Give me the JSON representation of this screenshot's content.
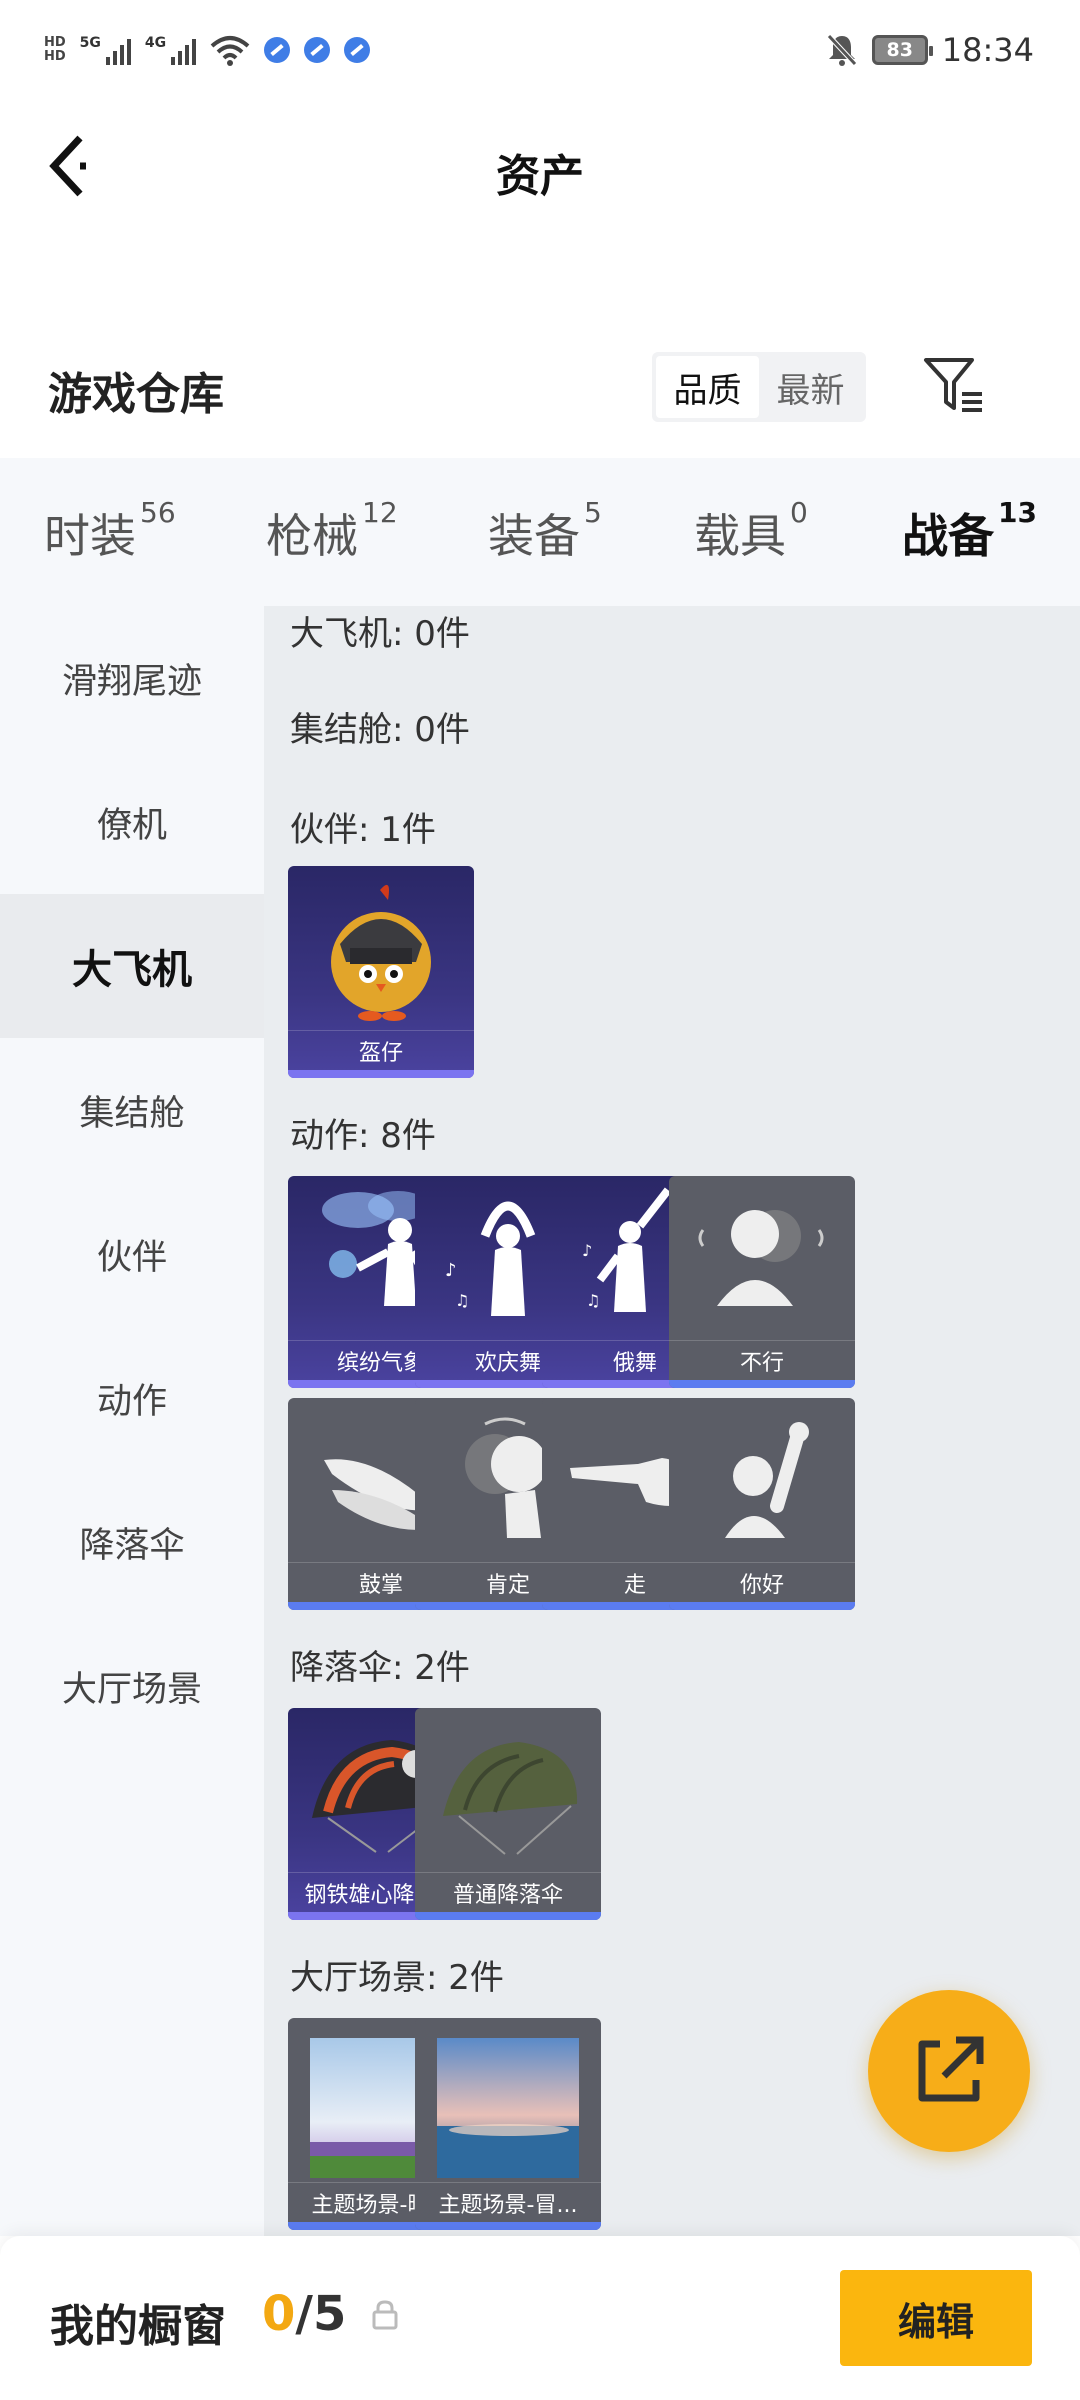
{
  "status_bar": {
    "network1": "5G",
    "network2": "4G",
    "battery": "83",
    "time": "18:34"
  },
  "header": {
    "title": "资产"
  },
  "section": {
    "title": "游戏仓库",
    "sort_options": [
      "品质",
      "最新"
    ]
  },
  "tabs": [
    {
      "label": "时装",
      "count": "56"
    },
    {
      "label": "枪械",
      "count": "12"
    },
    {
      "label": "装备",
      "count": "5"
    },
    {
      "label": "载具",
      "count": "0"
    },
    {
      "label": "战备",
      "count": "13"
    }
  ],
  "sidebar": {
    "items": [
      "滑翔尾迹",
      "僚机",
      "大飞机",
      "集结舱",
      "伙伴",
      "动作",
      "降落伞",
      "大厅场景"
    ],
    "active": "大飞机"
  },
  "groups": {
    "plane": "大飞机: 0件",
    "capsule": "集结舱: 0件",
    "companion": "伙伴: 1件",
    "emote": "动作: 8件",
    "parachute": "降落伞: 2件",
    "lobby": "大厅场景: 2件"
  },
  "items": {
    "companion": [
      "盔仔"
    ],
    "emote": [
      "缤纷气象",
      "欢庆舞",
      "俄舞",
      "不行",
      "鼓掌",
      "肯定",
      "走",
      "你好"
    ],
    "parachute": [
      "钢铁雄心降落...",
      "普通降落伞"
    ],
    "lobby": [
      "主题场景-晴...",
      "主题场景-冒..."
    ]
  },
  "bottom": {
    "label": "我的橱窗",
    "current": "0",
    "sep_total": "/5",
    "edit": "编辑"
  },
  "colors": {
    "accent": "#f6b012",
    "card_purple": "#3a3582",
    "card_gray": "#5b5d66"
  }
}
